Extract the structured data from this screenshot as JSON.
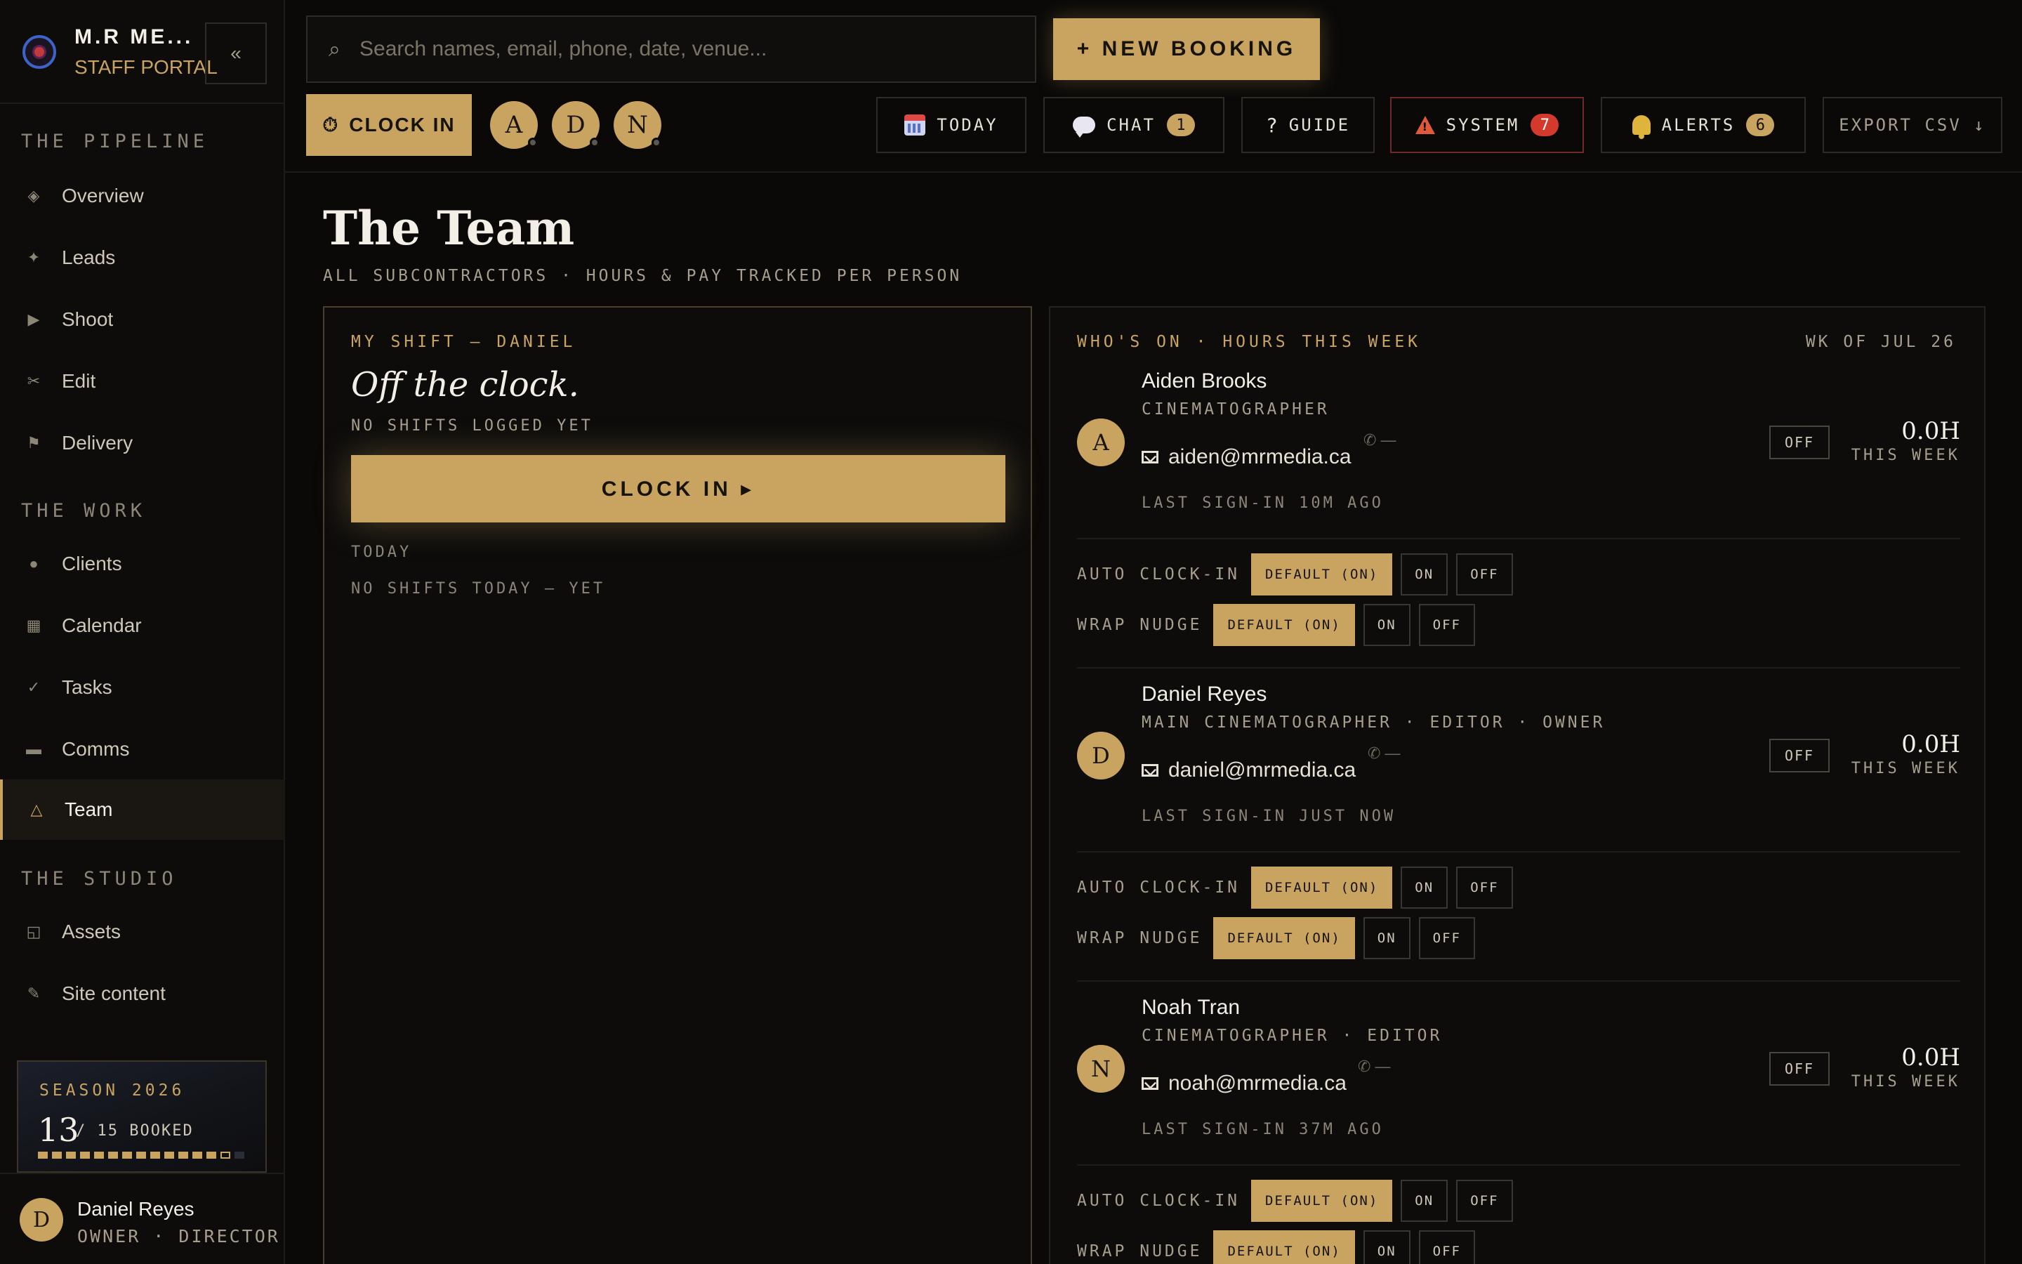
{
  "brand": {
    "name": "M.R ME...",
    "subtitle": "STAFF PORTAL",
    "collapse": "«"
  },
  "sidebar": {
    "sections": [
      {
        "title": "THE PIPELINE",
        "items": [
          {
            "label": "Overview",
            "icon": "◈"
          },
          {
            "label": "Leads",
            "icon": "✦"
          },
          {
            "label": "Shoot",
            "icon": "▶"
          },
          {
            "label": "Edit",
            "icon": "✂"
          },
          {
            "label": "Delivery",
            "icon": "⚑"
          }
        ]
      },
      {
        "title": "THE WORK",
        "items": [
          {
            "label": "Clients",
            "icon": "●"
          },
          {
            "label": "Calendar",
            "icon": "▦"
          },
          {
            "label": "Tasks",
            "icon": "✓"
          },
          {
            "label": "Comms",
            "icon": "▬"
          },
          {
            "label": "Team",
            "icon": "△",
            "active": true
          }
        ]
      },
      {
        "title": "THE STUDIO",
        "items": [
          {
            "label": "Assets",
            "icon": "◱"
          },
          {
            "label": "Site content",
            "icon": "✎"
          }
        ]
      }
    ],
    "season": {
      "title": "SEASON 2026",
      "booked": "13",
      "of_label": "/ 15 BOOKED",
      "booked_count": 13,
      "total": 15,
      "progress": 0.867
    },
    "user": {
      "initial": "D",
      "name": "Daniel Reyes",
      "role": "OWNER · DIRECTOR"
    }
  },
  "topbar": {
    "search": {
      "placeholder": "Search names, email, phone, date, venue...",
      "value": ""
    },
    "new_booking": "+ NEW BOOKING",
    "clock_in": "CLOCK IN",
    "presence": [
      "A",
      "D",
      "N"
    ],
    "buttons": {
      "today": "TODAY",
      "chat": {
        "label": "CHAT",
        "count": "1"
      },
      "guide": {
        "label": "GUIDE",
        "icon": "?"
      },
      "system": {
        "label": "SYSTEM",
        "count": "7"
      },
      "alerts": {
        "label": "ALERTS",
        "count": "6"
      },
      "export": "EXPORT CSV ↓"
    }
  },
  "page": {
    "title": "The Team",
    "subtitle": "ALL SUBCONTRACTORS · HOURS & PAY TRACKED PER PERSON"
  },
  "my_shift": {
    "label": "MY SHIFT — DANIEL",
    "state": "Off the clock.",
    "note": "NO SHIFTS LOGGED YET",
    "button": "CLOCK IN ▸",
    "today_label": "TODAY",
    "today_note": "NO SHIFTS TODAY — YET"
  },
  "team": {
    "label": "WHO'S ON · HOURS THIS WEEK",
    "week_of": "WK OF JUL 26",
    "hours_caption": "THIS WEEK",
    "setting_labels": {
      "auto": "AUTO CLOCK-IN",
      "wrap": "WRAP NUDGE"
    },
    "option_labels": [
      "DEFAULT (ON)",
      "ON",
      "OFF"
    ],
    "members": [
      {
        "initial": "A",
        "name": "Aiden Brooks",
        "role": "CINEMATOGRAPHER",
        "email": "aiden@mrmedia.ca",
        "phone": "✆ —",
        "last": "LAST SIGN-IN 10M AGO",
        "status": "OFF",
        "hours": "0.0H",
        "auto": "DEFAULT (ON)",
        "wrap": "DEFAULT (ON)"
      },
      {
        "initial": "D",
        "name": "Daniel Reyes",
        "role": "MAIN CINEMATOGRAPHER · EDITOR · OWNER",
        "email": "daniel@mrmedia.ca",
        "phone": "✆ —",
        "last": "LAST SIGN-IN JUST NOW",
        "status": "OFF",
        "hours": "0.0H",
        "auto": "DEFAULT (ON)",
        "wrap": "DEFAULT (ON)"
      },
      {
        "initial": "N",
        "name": "Noah Tran",
        "role": "CINEMATOGRAPHER · EDITOR",
        "email": "noah@mrmedia.ca",
        "phone": "✆ —",
        "last": "LAST SIGN-IN 37M AGO",
        "status": "OFF",
        "hours": "0.0H",
        "auto": "DEFAULT (ON)",
        "wrap": "DEFAULT (ON)"
      }
    ]
  },
  "colors": {
    "accent": "#c9a461",
    "background": "#0a0908",
    "danger": "#d33a2c"
  }
}
